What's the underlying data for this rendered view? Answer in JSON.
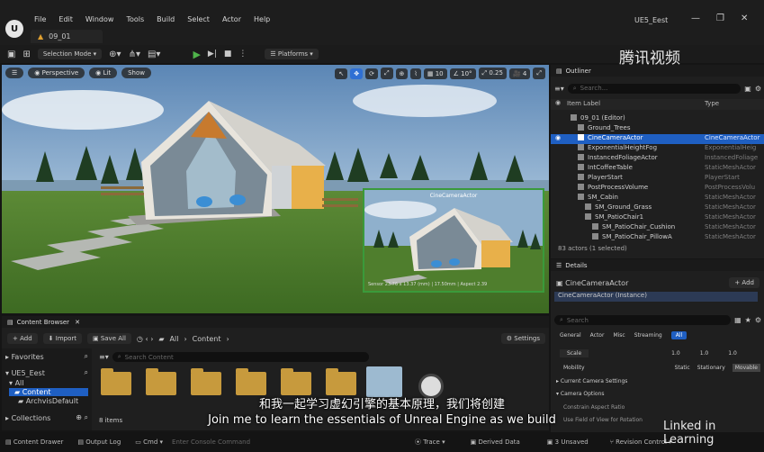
{
  "app": {
    "logo": "U",
    "project_title": "UE5_Eest",
    "level_tab": "09_01"
  },
  "menu": [
    "File",
    "Edit",
    "Window",
    "Tools",
    "Build",
    "Select",
    "Actor",
    "Help"
  ],
  "window_controls": [
    "—",
    "❐",
    "✕"
  ],
  "toolbar": {
    "selection_mode": "Selection Mode",
    "platforms": "Platforms"
  },
  "viewport": {
    "perspective": "Perspective",
    "lit": "Lit",
    "show": "Show",
    "grid_snap": "10",
    "rot_snap": "10°",
    "scale_snap": "0.25",
    "cam_speed": "4",
    "cine_label": "CineCameraActor",
    "cine_readout": "Sensor 23.76 x 13.37 (mm) | 17.50mm | Aspect 2.39"
  },
  "outliner": {
    "title": "Outliner",
    "search_placeholder": "Search...",
    "col_label": "Item Label",
    "col_type": "Type",
    "rows": [
      {
        "label": "09_01 (Editor)",
        "type": "",
        "indent": 0,
        "selected": false
      },
      {
        "label": "Ground_Trees",
        "type": "",
        "indent": 1,
        "selected": false
      },
      {
        "label": "CineCameraActor",
        "type": "CineCameraActor",
        "indent": 1,
        "selected": true
      },
      {
        "label": "ExponentialHeightFog",
        "type": "ExponentialHeig",
        "indent": 1,
        "selected": false
      },
      {
        "label": "InstancedFoliageActor",
        "type": "InstancedFoliage",
        "indent": 1,
        "selected": false
      },
      {
        "label": "IntCoffeeTable",
        "type": "StaticMeshActor",
        "indent": 1,
        "selected": false
      },
      {
        "label": "PlayerStart",
        "type": "PlayerStart",
        "indent": 1,
        "selected": false
      },
      {
        "label": "PostProcessVolume",
        "type": "PostProcessVolu",
        "indent": 1,
        "selected": false
      },
      {
        "label": "SM_Cabin",
        "type": "StaticMeshActor",
        "indent": 1,
        "selected": false
      },
      {
        "label": "SM_Ground_Grass",
        "type": "StaticMeshActor",
        "indent": 2,
        "selected": false
      },
      {
        "label": "SM_PatioChair1",
        "type": "StaticMeshActor",
        "indent": 2,
        "selected": false
      },
      {
        "label": "SM_PatioChair_Cushion",
        "type": "StaticMeshActor",
        "indent": 3,
        "selected": false
      },
      {
        "label": "SM_PatioChair_PillowA",
        "type": "StaticMeshActor",
        "indent": 3,
        "selected": false
      }
    ],
    "count": "83 actors (1 selected)"
  },
  "details": {
    "title": "Details",
    "actor_name": "CineCameraActor",
    "add_label": "+ Add",
    "instance": "CineCameraActor (Instance)",
    "search_placeholder": "Search",
    "tabs": [
      "General",
      "Actor",
      "Misc",
      "Streaming",
      "All"
    ],
    "active_tab": "All",
    "scale_label": "Scale",
    "scale_values": [
      "1.0",
      "1.0",
      "1.0"
    ],
    "mobility_label": "Mobility",
    "mobility_options": [
      "Static",
      "Stationary",
      "Movable"
    ],
    "mobility_active": "Movable",
    "sections": [
      "Current Camera Settings",
      "Camera Options"
    ],
    "option_rows": [
      "Constrain Aspect Ratio",
      "Use Field of View for Rotation"
    ]
  },
  "content_browser": {
    "title": "Content Browser",
    "add": "+ Add",
    "import": "Import",
    "save_all": "Save All",
    "path": [
      "All",
      "Content"
    ],
    "settings": "Settings",
    "favorites": "Favorites",
    "project": "UE5_Eest",
    "tree": [
      "All",
      "Content",
      "ArchvisDefault"
    ],
    "collections": "Collections",
    "search_placeholder": "Search Content",
    "items_count": "8 items"
  },
  "status_bar": {
    "content_drawer": "Content Drawer",
    "output_log": "Output Log",
    "cmd": "Cmd",
    "console_placeholder": "Enter Console Command",
    "trace": "Trace",
    "derived_data": "Derived Data",
    "unsaved": "3 Unsaved",
    "revision_control": "Revision Control"
  },
  "subtitles": {
    "cn": "和我一起学习虚幻引擎的基本原理，我们将创建",
    "en": "Join me to learn the essentials of Unreal Engine as we build"
  },
  "watermarks": {
    "tencent": "腾讯视频",
    "linkedin": "Linked in Learning"
  },
  "colors": {
    "accent": "#1f5fc2",
    "play": "#4fb34a",
    "cine_border": "#3a9a3a"
  }
}
